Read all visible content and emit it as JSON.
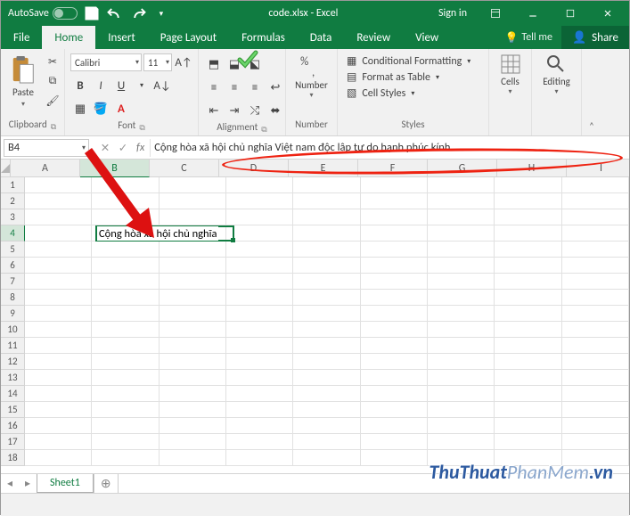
{
  "titlebar": {
    "autosave": "AutoSave",
    "autosave_state": "Off",
    "filename": "code.xlsx - Excel",
    "signin": "Sign in"
  },
  "tabs": {
    "file": "File",
    "home": "Home",
    "insert": "Insert",
    "page_layout": "Page Layout",
    "formulas": "Formulas",
    "data": "Data",
    "review": "Review",
    "view": "View",
    "tellme": "Tell me",
    "share": "Share"
  },
  "ribbon": {
    "clipboard": {
      "label": "Clipboard",
      "paste": "Paste"
    },
    "font": {
      "label": "Font",
      "name": "Calibri",
      "size": "11"
    },
    "alignment": {
      "label": "Alignment"
    },
    "number": {
      "label": "Number",
      "btn": "Number"
    },
    "styles": {
      "label": "Styles",
      "cond": "Conditional Formatting",
      "table": "Format as Table",
      "cell": "Cell Styles"
    },
    "cells": {
      "label": "Cells",
      "btn": "Cells"
    },
    "editing": {
      "label": "Editing",
      "btn": "Editing"
    }
  },
  "fbar": {
    "namebox": "B4",
    "formula": "Cộng hòa xã hội chủ nghĩa Việt nam độc lập tự do hạnh phúc kính"
  },
  "grid": {
    "columns": [
      "A",
      "B",
      "C",
      "D",
      "E",
      "F",
      "G",
      "H",
      "I"
    ],
    "rows": [
      "1",
      "2",
      "3",
      "4",
      "5",
      "6",
      "7",
      "8",
      "9",
      "10",
      "11",
      "12",
      "13",
      "14",
      "15",
      "16",
      "17",
      "18"
    ],
    "active_cell_display": "Cộng hòa xã hội chủ nghĩa",
    "selected_col": "B",
    "selected_row": "4"
  },
  "sheets": {
    "add": "+",
    "sheet1": "Sheet1"
  },
  "watermark": {
    "a": "ThuThuat",
    "b": "PhanMem",
    "c": ".vn"
  }
}
